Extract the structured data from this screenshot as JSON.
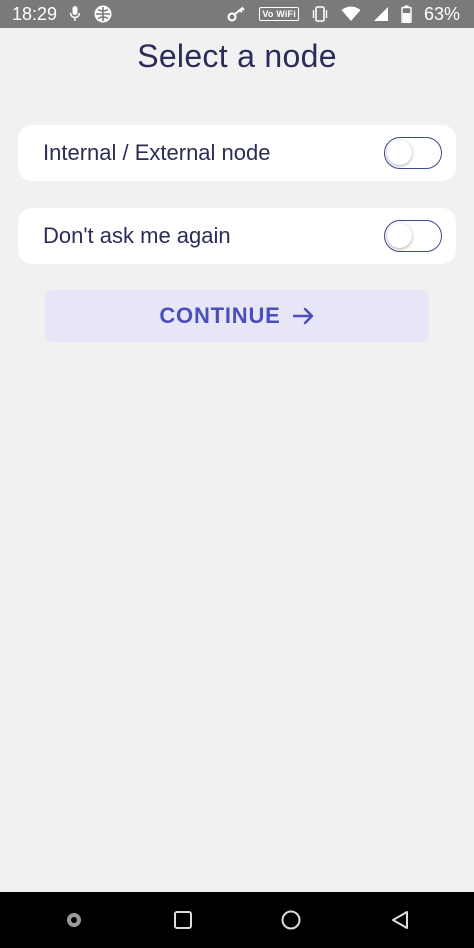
{
  "status_bar": {
    "time": "18:29",
    "vowifi_label": "Vo WiFi",
    "battery_percent": "63%",
    "icons_left": [
      "mic-icon",
      "vpn-globe-icon"
    ],
    "icons_right": [
      "key-icon",
      "vowifi-icon",
      "vibrate-icon",
      "wifi-icon",
      "signal-icon",
      "battery-icon"
    ]
  },
  "page": {
    "title": "Select a node"
  },
  "options": [
    {
      "label": "Internal / External node",
      "enabled": false
    },
    {
      "label": "Don't ask me again",
      "enabled": false
    }
  ],
  "continue_button": {
    "label": "CONTINUE",
    "icon": "arrow-right-icon"
  },
  "colors": {
    "title": "#2b2d57",
    "accent": "#4b4fb8",
    "button_bg": "#e7e6f6",
    "background": "#f1f1f1",
    "status_bar": "#7a7a7a"
  },
  "nav_bar": {
    "icons": [
      "dot-icon",
      "recents-square-icon",
      "home-circle-icon",
      "back-triangle-icon"
    ]
  }
}
